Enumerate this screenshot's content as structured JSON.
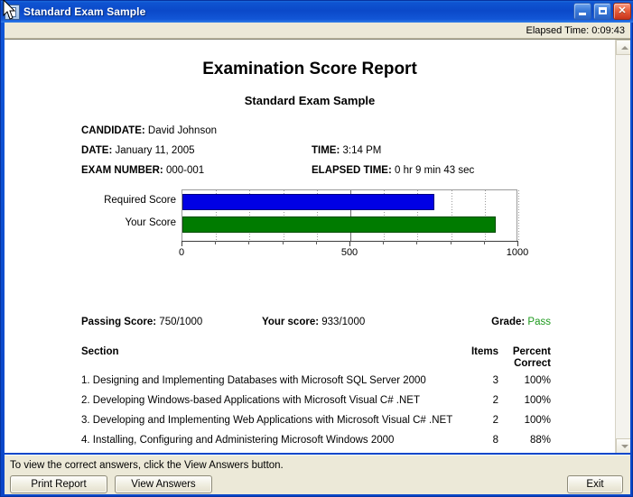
{
  "window": {
    "title": "Standard Exam Sample",
    "icon": "app-icon",
    "controls": {
      "minimize": "Minimize",
      "maximize": "Maximize",
      "close": "Close"
    }
  },
  "toolbar": {
    "elapsed_label": "Elapsed Time: 0:09:43"
  },
  "report": {
    "title": "Examination Score Report",
    "subtitle": "Standard Exam Sample",
    "fields": {
      "candidate_label": "CANDIDATE:",
      "candidate_value": "David Johnson",
      "date_label": "DATE:",
      "date_value": "January 11, 2005",
      "time_label": "TIME:",
      "time_value": "3:14 PM",
      "exam_number_label": "EXAM NUMBER:",
      "exam_number_value": "000-001",
      "elapsed_time_label": "ELAPSED TIME:",
      "elapsed_time_value": "0 hr 9 min 43 sec"
    },
    "summary": {
      "passing_score_label": "Passing Score:",
      "passing_score_value": "750/1000",
      "your_score_label": "Your score:",
      "your_score_value": "933/1000",
      "grade_label": "Grade:",
      "grade_value": "Pass"
    },
    "table": {
      "headers": {
        "section": "Section",
        "items": "Items",
        "percent_line1": "Percent",
        "percent_line2": "Correct"
      },
      "rows": [
        {
          "section": "1. Designing and Implementing Databases with Microsoft SQL Server 2000",
          "items": "3",
          "percent": "100%"
        },
        {
          "section": "2. Developing Windows-based Applications with Microsoft Visual C# .NET",
          "items": "2",
          "percent": "100%"
        },
        {
          "section": "3. Developing and Implementing Web Applications with Microsoft Visual C# .NET",
          "items": "2",
          "percent": "100%"
        },
        {
          "section": "4. Installing, Configuring and Administering Microsoft Windows 2000",
          "items": "8",
          "percent": "88%"
        }
      ]
    }
  },
  "chart_data": {
    "type": "bar",
    "orientation": "horizontal",
    "title": "",
    "xlabel": "",
    "ylabel": "",
    "categories": [
      "Required Score",
      "Your Score"
    ],
    "values": [
      750,
      933
    ],
    "colors": [
      "#0000e4",
      "#007b00"
    ],
    "xlim": [
      0,
      1000
    ],
    "xticks": [
      0,
      100,
      200,
      300,
      400,
      500,
      600,
      700,
      800,
      900,
      1000
    ],
    "xtick_labels": [
      "0",
      "",
      "",
      "",
      "",
      "500",
      "",
      "",
      "",
      "",
      "1000"
    ],
    "grid": true,
    "legend": false
  },
  "status": {
    "message": "To view the correct answers, click the View Answers button."
  },
  "buttons": {
    "print": "Print Report",
    "view_answers": "View Answers",
    "exit": "Exit"
  },
  "scrollbar": {
    "up": "scroll-up",
    "down": "scroll-down"
  }
}
